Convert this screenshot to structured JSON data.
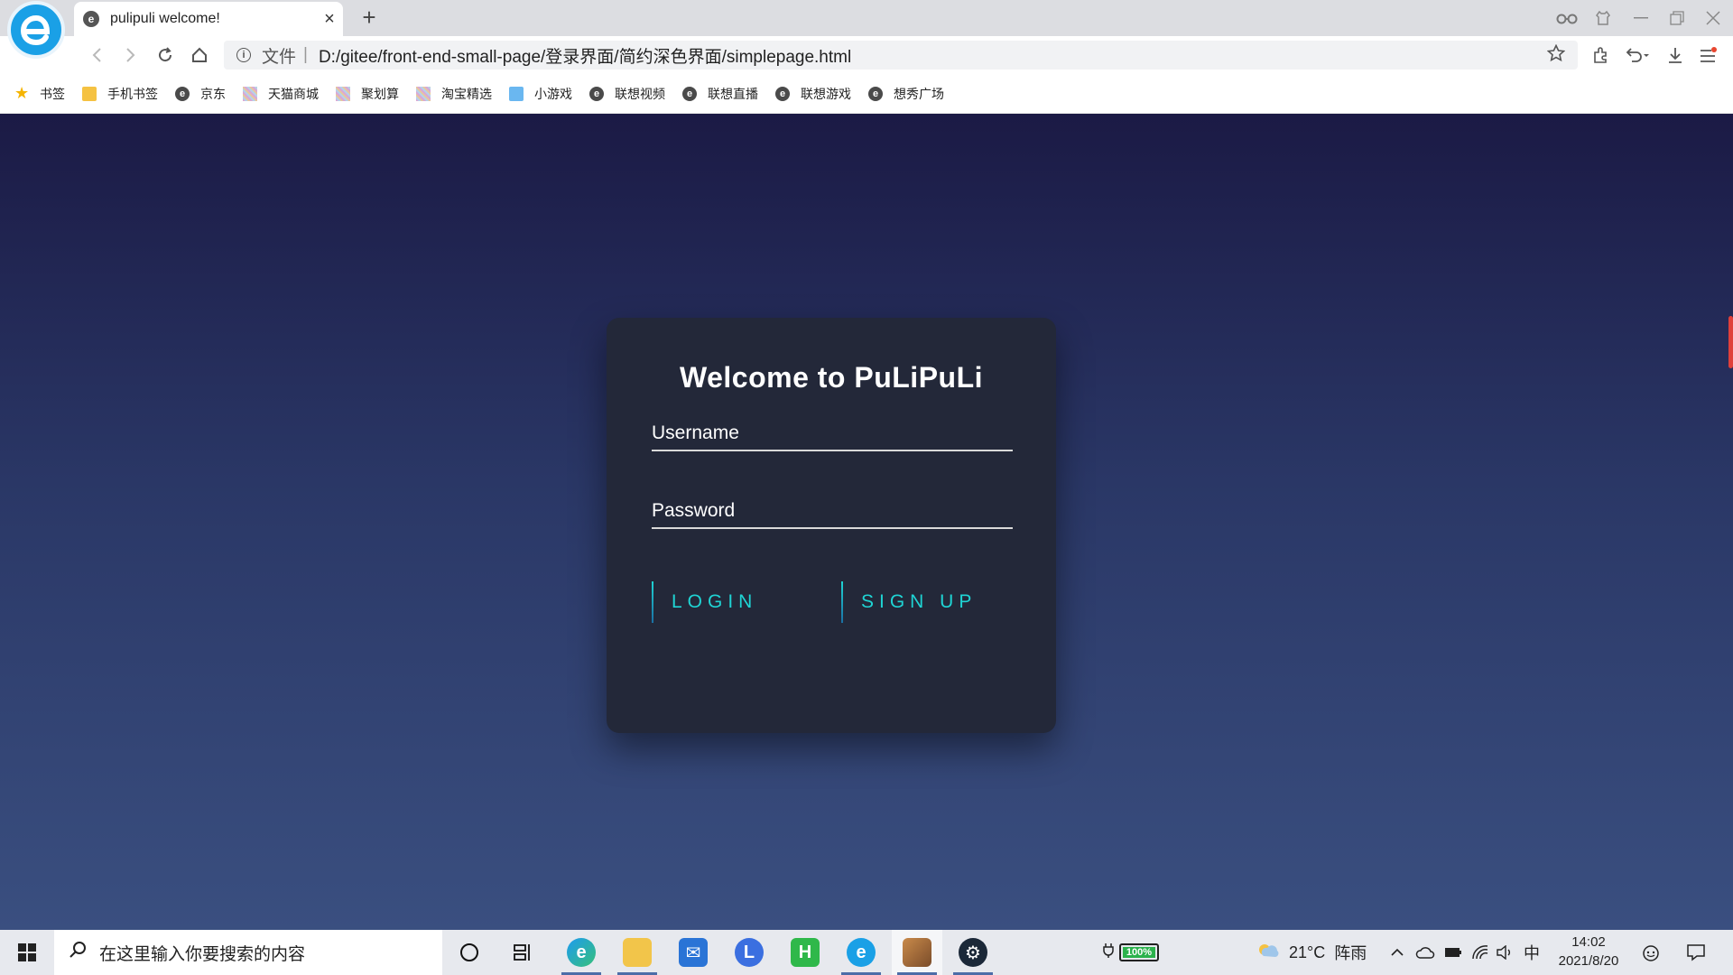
{
  "browser": {
    "tab_title": "pulipuli welcome!",
    "tab_close": "×",
    "new_tab": "+",
    "url_prefix": "文件",
    "url_separator": "|",
    "url": "D:/gitee/front-end-small-page/登录界面/简约深色界面/simplepage.html"
  },
  "bookmarks": [
    {
      "label": "书签",
      "icon": "star-icon"
    },
    {
      "label": "手机书签",
      "icon": "phone-icon"
    },
    {
      "label": "京东",
      "icon": "e-icon"
    },
    {
      "label": "天猫商城",
      "icon": "pixel-icon"
    },
    {
      "label": "聚划算",
      "icon": "pixel-icon"
    },
    {
      "label": "淘宝精选",
      "icon": "pixel-icon"
    },
    {
      "label": "小游戏",
      "icon": "game-icon"
    },
    {
      "label": "联想视频",
      "icon": "e-icon"
    },
    {
      "label": "联想直播",
      "icon": "e-icon"
    },
    {
      "label": "联想游戏",
      "icon": "e-icon"
    },
    {
      "label": "想秀广场",
      "icon": "e-icon"
    }
  ],
  "login": {
    "title": "Welcome to PuLiPuLi",
    "username_label": "Username",
    "password_label": "Password",
    "login_button": "LOGIN",
    "signup_button": "SIGN UP"
  },
  "taskbar": {
    "search_placeholder": "在这里输入你要搜索的内容",
    "battery": "100%",
    "temperature": "21°C",
    "weather": "阵雨",
    "ime": "中",
    "time": "14:02",
    "date": "2021/8/20"
  },
  "colors": {
    "page_bg_top": "#1b1a45",
    "page_bg_bottom": "#3a4f80",
    "card_bg": "#232839",
    "accent": "#1fd4d4"
  }
}
